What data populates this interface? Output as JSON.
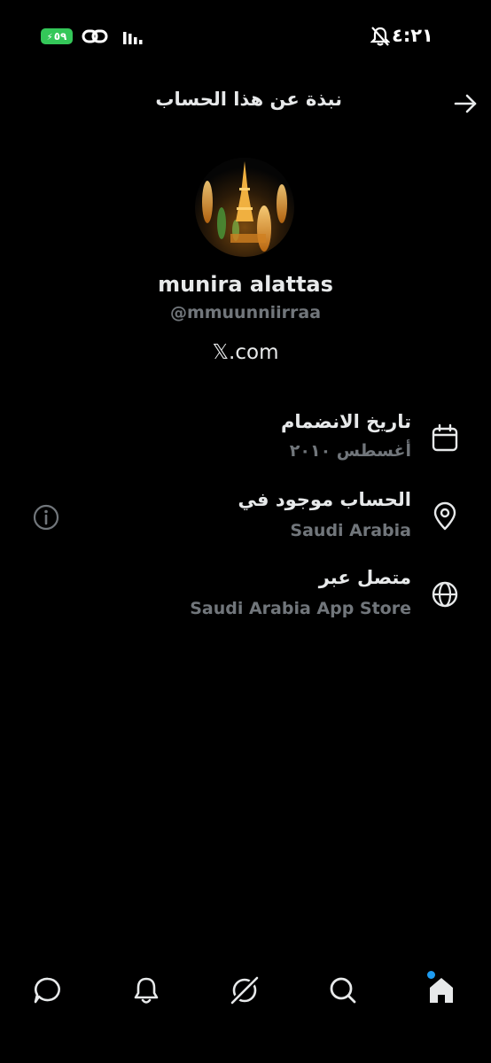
{
  "status_bar": {
    "battery": "٥٩",
    "time": "٤:٢١"
  },
  "header": {
    "title": "نبذة عن هذا الحساب"
  },
  "profile": {
    "display_name": "munira alattas",
    "handle": "@mmuunniirraa",
    "verified_via": "𝕏.com"
  },
  "info": {
    "joined": {
      "label": "تاريخ الانضمام",
      "value": "أغسطس ٢٠١٠"
    },
    "location": {
      "label": "الحساب موجود في",
      "value": "Saudi Arabia"
    },
    "connected": {
      "label": "متصل عبر",
      "value": "Saudi Arabia App Store"
    }
  },
  "colors": {
    "accent": "#1d9bf0",
    "text": "#e7e9ea",
    "muted": "#71767b",
    "battery": "#34c759"
  }
}
